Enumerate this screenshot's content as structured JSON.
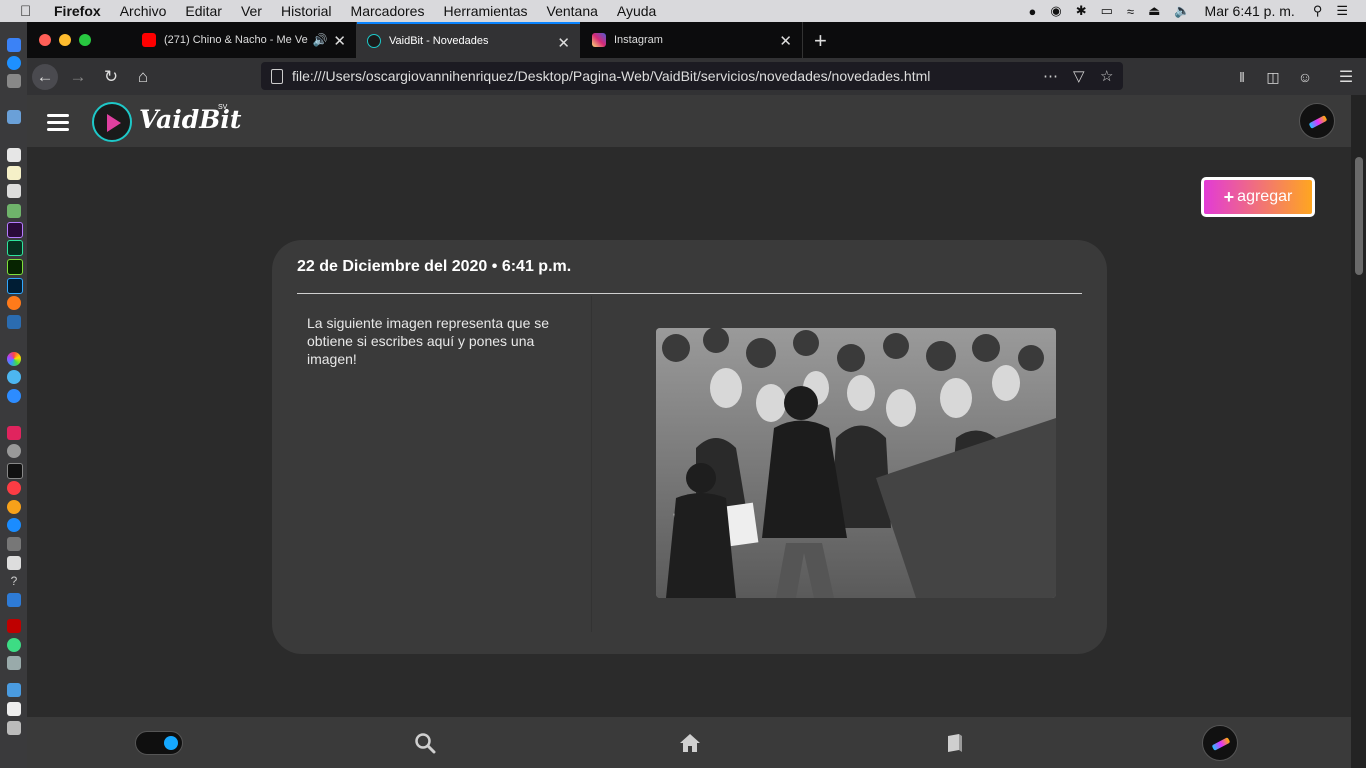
{
  "menubar": {
    "app": "Firefox",
    "items": [
      "Archivo",
      "Editar",
      "Ver",
      "Historial",
      "Marcadores",
      "Herramientas",
      "Ventana",
      "Ayuda"
    ],
    "clock": "Mar 6:41 p. m."
  },
  "tabs": [
    {
      "label": "(271) Chino & Nacho - Me Ve",
      "favicon": "youtube-icon",
      "color": "#ff0000"
    },
    {
      "label": "VaidBit - Novedades",
      "favicon": "vaidbit-icon",
      "color": "#1ec8c8",
      "active": true
    },
    {
      "label": "Instagram",
      "favicon": "instagram-icon",
      "color": "#d6249f"
    }
  ],
  "nav": {
    "url": "file:///Users/oscargiovannihenriquez/Desktop/Pagina-Web/VaidBit/servicios/novedades/novedades.html"
  },
  "app": {
    "brand": "VaidBit",
    "brand_sup": "SV",
    "add_button": "agregar",
    "accent_gradient": [
      "#e23bd6",
      "#ffa620"
    ]
  },
  "post": {
    "date": "22 de Diciembre del 2020 • 6:41 p.m.",
    "text": "La siguiente imagen representa que se obtiene si escribes aquí y pones una imagen!"
  },
  "bottom_nav": {
    "icons": [
      "toggle-switch",
      "search-icon",
      "home-icon",
      "book-icon",
      "avatar"
    ]
  }
}
